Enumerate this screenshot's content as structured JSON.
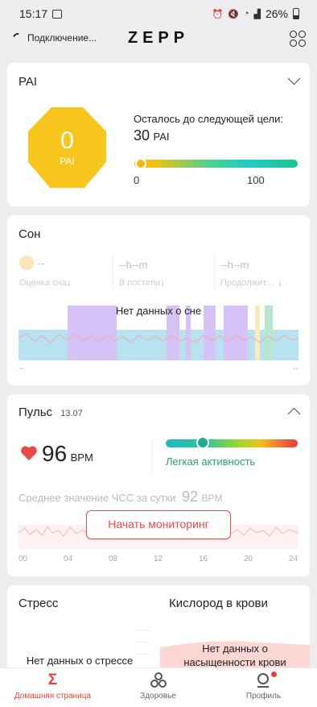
{
  "status": {
    "time": "15:17",
    "battery": "26%"
  },
  "header": {
    "connection": "Подключение...",
    "logo": "ZEPP"
  },
  "pai": {
    "title": "PAI",
    "value": "0",
    "unit": "PAI",
    "remaining_label": "Осталось до следующей цели:",
    "remaining_value": "30",
    "remaining_unit": "PAI",
    "progress_min": "0",
    "progress_max": "100",
    "progress": 0
  },
  "sleep": {
    "title": "Сон",
    "score_value": "--",
    "score_label": "Оценка сна",
    "inbed_value": "--h--m",
    "inbed_label": "В постели",
    "duration_value": "--h--m",
    "duration_label": "Продолжит...",
    "no_data": "Нет данных о сне",
    "axis_left": "--",
    "axis_right": "--"
  },
  "pulse": {
    "title": "Пульс",
    "date": "13.07",
    "value": "96",
    "unit": "BPM",
    "zone": "Легкая активность",
    "avg_label": "Среднее значение ЧСС за сутки",
    "avg_value": "92",
    "avg_unit": "BPM",
    "monitor_button": "Начать мониторинг",
    "hours": [
      "00",
      "04",
      "08",
      "12",
      "16",
      "20",
      "24"
    ],
    "colors": {
      "heart": "#e84a4a",
      "zone_text": "#2aa16a",
      "button": "#e84a4a"
    }
  },
  "stress": {
    "title": "Стресс",
    "no_data": "Нет данных о стрессе"
  },
  "oxygen": {
    "title": "Кислород в крови",
    "no_data_1": "Нет данных о",
    "no_data_2": "насыщенности крови"
  },
  "nav": {
    "home": "Домашняя страница",
    "health": "Здоровье",
    "profile": "Профиль",
    "active_color": "#e8403a"
  }
}
